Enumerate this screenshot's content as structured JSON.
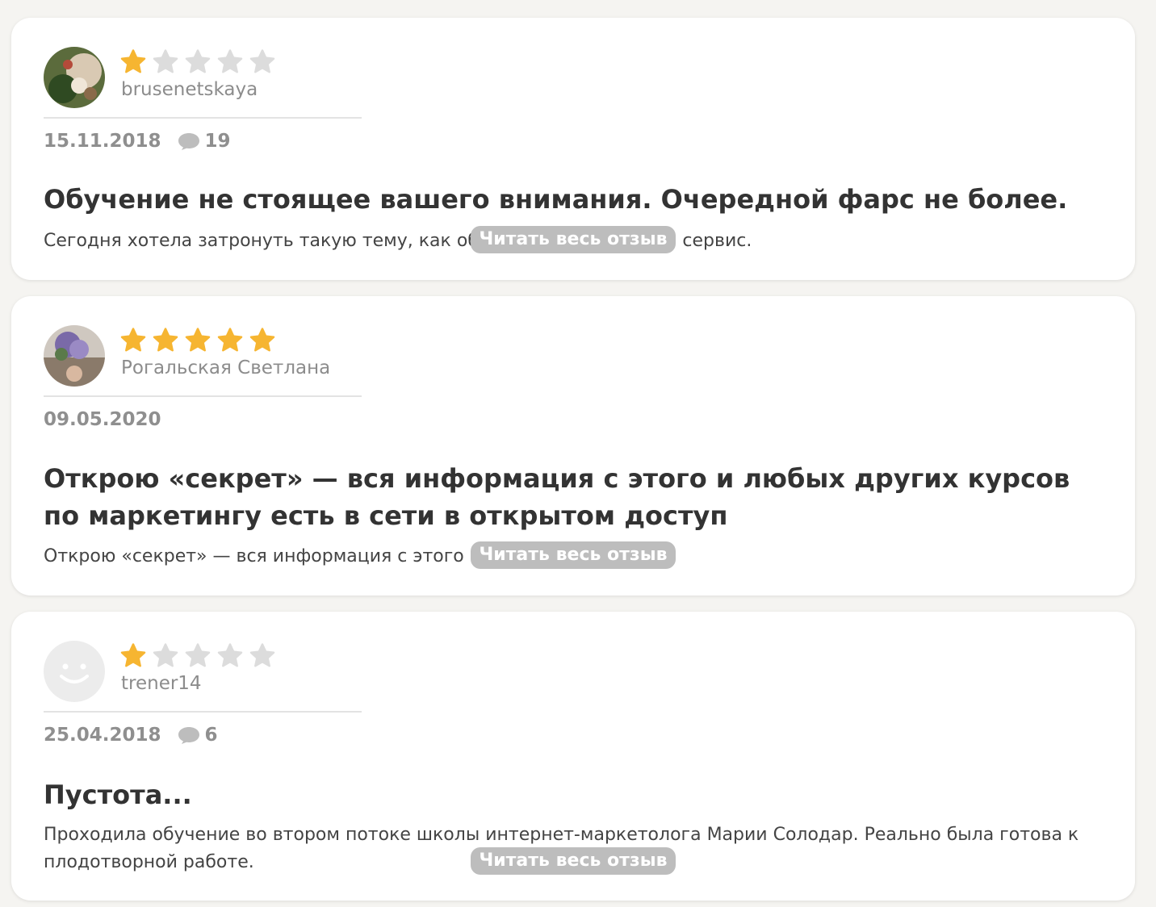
{
  "colors": {
    "star_on": "#f6b531",
    "star_off": "#dcdcdc",
    "read_more_bg": "#bdbdbd"
  },
  "reviews": [
    {
      "author": "brusenetskaya",
      "rating": 1,
      "date": "15.11.2018",
      "comments_count": "19",
      "avatar_icon": "user-photo-icon",
      "title": "Обучение не стоящее вашего внимания. Очередной фарс не более.",
      "excerpt": "Сегодня хотела затронуть такую тему, как обучение через онлайн сервис.",
      "read_more": "Читать весь отзыв"
    },
    {
      "author": "Рогальская Светлана",
      "rating": 5,
      "date": "09.05.2020",
      "comments_count": "",
      "avatar_icon": "user-photo-icon",
      "title": "Открою «секрет» — вся информация с этого и любых других курсов по маркетингу есть в сети в открытом доступ",
      "excerpt": "Открою «секрет» — вся информация с этого",
      "read_more": "Читать весь отзыв"
    },
    {
      "author": "trener14",
      "rating": 1,
      "date": "25.04.2018",
      "comments_count": "6",
      "avatar_icon": "default-avatar-smiley-icon",
      "title": "Пустота...",
      "excerpt": "Проходила обучение во втором потоке школы интернет-маркетолога Марии Солодар. Реально была готова к плодотворной работе.",
      "read_more": "Читать весь отзыв"
    }
  ]
}
